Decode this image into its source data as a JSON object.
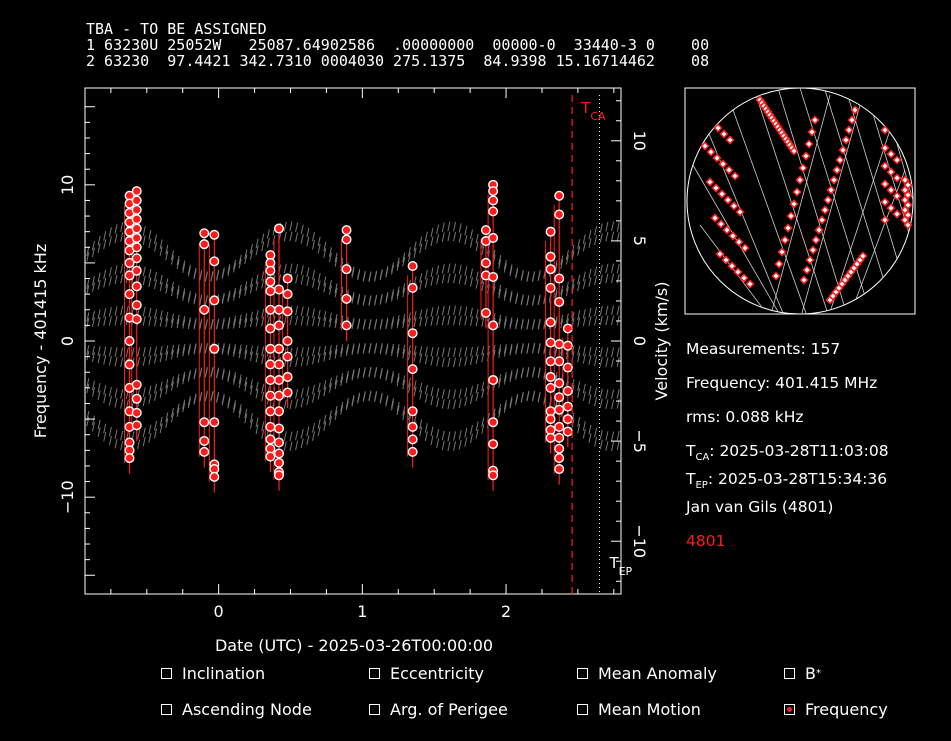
{
  "header": {
    "name": "TBA - TO BE ASSIGNED",
    "line1": "1 63230U 25052W   25087.64902586  .00000000  00000-0  33440-3 0    00",
    "line2": "2 63230  97.4421 342.7310 0004030 275.1375  84.9398 15.16714462    08"
  },
  "info": {
    "measurements": "Measurements: 157",
    "frequency": "Frequency: 401.415 MHz",
    "rms": "rms: 0.088 kHz",
    "tca_label": "T",
    "tca_sub": "CA",
    "tca_value": ": 2025-03-28T11:03:08",
    "tep_label": "T",
    "tep_sub": "EP",
    "tep_value": ": 2025-03-28T15:34:36",
    "observer": "Jan van Gils (4801)",
    "site": "4801"
  },
  "colors": {
    "accent": "#ff1a1a",
    "model": "#777777",
    "bg": "#000000",
    "fg": "#ffffff"
  },
  "checkboxes": [
    {
      "label": "Inclination",
      "checked": false
    },
    {
      "label": "Eccentricity",
      "checked": false
    },
    {
      "label": "Mean Anomaly",
      "checked": false
    },
    {
      "label": "B",
      "sup": "*",
      "checked": false
    },
    {
      "label": "Ascending Node",
      "checked": false
    },
    {
      "label": "Arg. of Perigee",
      "checked": false
    },
    {
      "label": "Mean Motion",
      "checked": false
    },
    {
      "label": "Frequency",
      "checked": true
    }
  ],
  "chart_data": {
    "type": "scatter",
    "xlabel": "Date (UTC) - 2025-03-26T00:00:00",
    "ylabel": "Frequency - 401415 kHz",
    "y2label": "Velocity (km/s)",
    "xlim": [
      -0.93,
      2.8
    ],
    "ylim": [
      -16.2,
      16.2
    ],
    "x_ticks": [
      "0",
      "1",
      "2"
    ],
    "y_ticks": [
      "10",
      "0",
      "−10"
    ],
    "y2_ticks": [
      "10",
      "5",
      "0",
      "−5",
      "−10"
    ],
    "markers": {
      "tca": {
        "label": "T",
        "sub": "CA",
        "x": 2.46
      },
      "tep": {
        "label": "T",
        "sub": "EP",
        "x": 2.65
      }
    },
    "passes": [
      {
        "x": -0.62,
        "values": [
          9.3,
          8.8,
          8.2,
          7.6,
          7.0,
          6.4,
          5.8,
          5.0,
          4.2,
          3.0,
          1.5,
          0.0,
          -1.5,
          -3.0,
          -4.5,
          -5.5,
          -6.5,
          -7.0,
          -7.5
        ]
      },
      {
        "x": -0.57,
        "values": [
          9.6,
          9.0,
          8.4,
          7.8,
          7.2,
          6.6,
          6.0,
          5.3,
          4.5,
          3.5,
          2.3,
          1.4,
          -2.8,
          -3.7,
          -4.6,
          -5.4
        ]
      },
      {
        "x": -0.1,
        "values": [
          6.9,
          6.2,
          2.0,
          -5.2,
          -6.4,
          -7.1
        ]
      },
      {
        "x": -0.03,
        "values": [
          6.8,
          5.1,
          2.6,
          -0.5,
          -5.2,
          -7.9,
          -8.2,
          -8.7
        ]
      },
      {
        "x": 0.36,
        "values": [
          5.5,
          5.0,
          4.5,
          3.8,
          3.2,
          2.0,
          0.8,
          -0.5,
          -1.5,
          -2.5,
          -3.5,
          -4.5,
          -5.5,
          -6.3,
          -6.9,
          -7.4
        ]
      },
      {
        "x": 0.42,
        "values": [
          7.2,
          3.3,
          2.0,
          1.0,
          -0.5,
          -1.5,
          -2.5,
          -3.5,
          -4.5,
          -5.6,
          -6.5,
          -7.2,
          -7.8,
          -8.4,
          -8.6
        ]
      },
      {
        "x": 0.48,
        "values": [
          4.0,
          3.0,
          1.9,
          0.0,
          -1.0,
          -2.3,
          -3.3
        ]
      },
      {
        "x": 0.89,
        "values": [
          7.1,
          6.5,
          4.6,
          2.7,
          1.0
        ]
      },
      {
        "x": 1.35,
        "values": [
          4.8,
          3.4,
          0.5,
          -1.8,
          -4.5,
          -5.5,
          -6.3,
          -7.1
        ]
      },
      {
        "x": 1.86,
        "values": [
          7.1,
          6.4,
          5.0,
          4.2,
          1.8
        ]
      },
      {
        "x": 1.91,
        "values": [
          10.0,
          9.6,
          9.0,
          8.3,
          6.6,
          4.1,
          1.0,
          -2.5,
          -5.2,
          -6.6,
          -8.3,
          -8.6
        ]
      },
      {
        "x": 2.31,
        "values": [
          7.0,
          5.4,
          4.6,
          3.4,
          1.2,
          -0.1,
          -1.3,
          -2.3,
          -3.0,
          -4.5,
          -5.0,
          -5.7,
          -6.2
        ]
      },
      {
        "x": 2.37,
        "values": [
          9.3,
          8.1,
          4.0,
          2.5,
          -0.2,
          -1.3,
          -2.7,
          -3.6,
          -4.4,
          -5.5,
          -6.2,
          -6.9,
          -7.5,
          -8.2
        ]
      },
      {
        "x": 2.43,
        "values": [
          0.8,
          -0.3,
          -1.7,
          -3.2,
          -4.2,
          -5.0,
          -5.8
        ]
      }
    ],
    "dot_count": 157
  }
}
